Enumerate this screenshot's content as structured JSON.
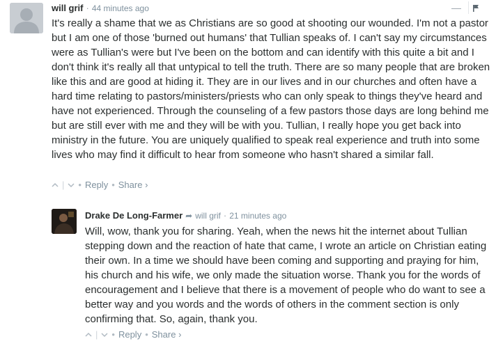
{
  "comments": [
    {
      "author": "will grif",
      "time": "44 minutes ago",
      "body": "It's really a shame that we as Christians are so good at shooting our wounded. I'm not a pastor but I am one of those 'burned out humans' that Tullian speaks of. I can't say my circumstances were as Tullian's were but I've been on the bottom and can identify with this quite a bit and I don't think it's really all that untypical to tell the truth. There are so many people that are broken like this and are good at hiding it. They are in our lives and in our churches and often have a hard time relating to pastors/ministers/priests who can only speak to things they've heard and have not experienced. Through the counseling of a few pastors those days are long behind me but are still ever with me and they will be with you. Tullian, I really hope you get back into ministry in the future. You are uniquely qualified to speak real experience and truth into some lives who may find it difficult to hear from someone who hasn't shared a similar fall.",
      "collapse_icon": "—",
      "upvote_icon": "^",
      "downvote_icon": "v",
      "reply_label": "Reply",
      "share_label": "Share ›"
    },
    {
      "author": "Drake De Long-Farmer",
      "reply_to": "will grif",
      "time": "21 minutes ago",
      "body": "Will, wow, thank you for sharing. Yeah, when the news hit the internet about Tullian stepping down and the reaction of hate that came, I wrote an article on Christian eating their own. In a time we should have been coming and supporting and praying for him, his church and his wife, we only made the situation worse. Thank you for the words of encouragement and I believe that there is a movement of people who do want to see a better way and you words and the words of others in the comment section is only confirming that. So, again, thank you.",
      "upvote_icon": "^",
      "downvote_icon": "v",
      "reply_label": "Reply",
      "share_label": "Share ›"
    }
  ],
  "icons": {
    "reply_arrow": "➦"
  },
  "colors": {
    "text": "#2a2e2e",
    "meta": "#7f919e",
    "avatar_default": "#c8cdd2"
  }
}
